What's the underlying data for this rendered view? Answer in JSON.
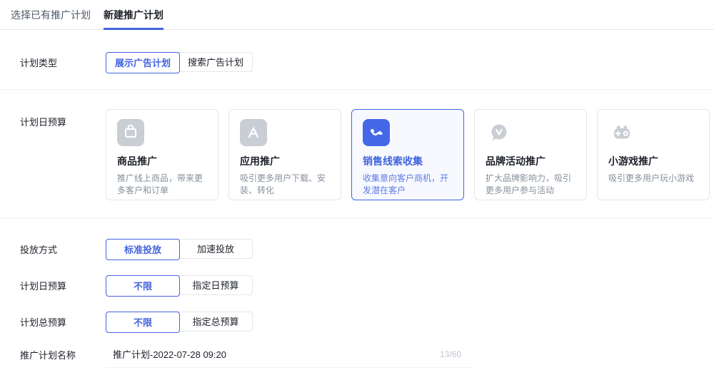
{
  "colors": {
    "accent": "#4264DE",
    "accent_soft": "#5E7BE6",
    "accent_bg": "#F7F9FF",
    "icon_gray": "#C9CDD4",
    "icon_blue": "#4467E8"
  },
  "tabs": {
    "items": [
      {
        "label": "选择已有推广计划",
        "active": false
      },
      {
        "label": "新建推广计划",
        "active": true
      }
    ]
  },
  "plan_type": {
    "label": "计划类型",
    "options": [
      {
        "label": "展示广告计划",
        "selected": true
      },
      {
        "label": "搜索广告计划",
        "selected": false
      }
    ]
  },
  "objectives": {
    "label": "计划日预算",
    "cards": [
      {
        "icon": "shopping-bag-icon",
        "title": "商品推广",
        "desc": "推广线上商品，带来更多客户和订单",
        "selected": false
      },
      {
        "icon": "app-store-icon",
        "title": "应用推广",
        "desc": "吸引更多用户下载、安装、转化",
        "selected": false
      },
      {
        "icon": "trend-line-icon",
        "title": "销售线索收集",
        "desc": "收集意向客户商机，开发潜在客户",
        "selected": true
      },
      {
        "icon": "chat-bubble-v-icon",
        "title": "品牌活动推广",
        "desc": "扩大品牌影响力，吸引更多用户参与活动",
        "selected": false
      },
      {
        "icon": "gamepad-icon",
        "title": "小游戏推广",
        "desc": "吸引更多用户玩小游戏",
        "selected": false
      }
    ]
  },
  "delivery": {
    "label": "投放方式",
    "options": [
      {
        "label": "标准投放",
        "selected": true
      },
      {
        "label": "加速投放",
        "selected": false
      }
    ]
  },
  "daily_budget": {
    "label": "计划日预算",
    "options": [
      {
        "label": "不限",
        "selected": true
      },
      {
        "label": "指定日预算",
        "selected": false
      }
    ]
  },
  "total_budget": {
    "label": "计划总预算",
    "options": [
      {
        "label": "不限",
        "selected": true
      },
      {
        "label": "指定总预算",
        "selected": false
      }
    ]
  },
  "plan_name": {
    "label": "推广计划名称",
    "value": "推广计划-2022-07-28 09:20",
    "counter": "13/60"
  }
}
